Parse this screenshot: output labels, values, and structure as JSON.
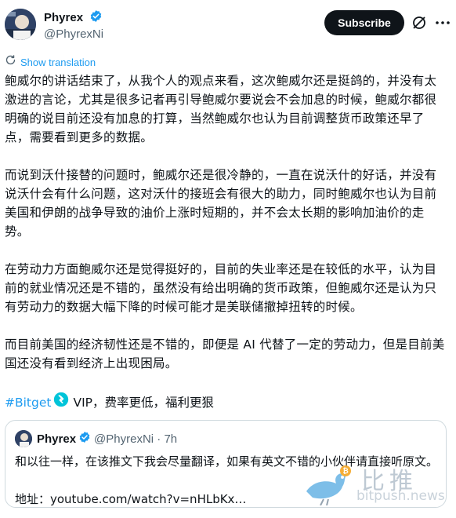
{
  "author": {
    "display_name": "Phyrex",
    "handle": "@PhyrexNi"
  },
  "actions": {
    "subscribe_label": "Subscribe"
  },
  "translate": {
    "label": "Show translation"
  },
  "tweet": {
    "paragraphs": [
      "鲍威尔的讲话结束了，从我个人的观点来看，这次鲍威尔还是挺鸽的，并没有太激进的言论，尤其是很多记者再引导鲍威尔要说会不会加息的时候，鲍威尔都很明确的说目前还没有加息的打算，当然鲍威尔也认为目前调整货币政策还早了点，需要看到更多的数据。",
      "而说到沃什接替的问题时，鲍威尔还是很冷静的，一直在说沃什的好话，并没有说沃什会有什么问题，这对沃什的接班会有很大的助力，同时鲍威尔也认为目前美国和伊朗的战争导致的油价上涨时短期的，并不会太长期的影响加油价的走势。",
      "在劳动力方面鲍威尔还是觉得挺好的，目前的失业率还是在较低的水平，认为目前的就业情况还是不错的，虽然没有给出明确的货币政策，但鲍威尔还是认为只有劳动力的数据大幅下降的时候可能才是美联储撤掉扭转的时候。",
      "而目前美国的经济韧性还是不错的，即便是 AI 代替了一定的劳动力，但是目前美国还没有看到经济上出现困局。"
    ],
    "hashtag": "#Bitget",
    "promo_text": "VIP，费率更低，福利更狠"
  },
  "quote": {
    "display_name": "Phyrex",
    "handle_time": "@PhyrexNi · 7h",
    "line1": "和以往一样，在该推文下我会尽量翻译，如果有英文不错的小伙伴请直接听原文。",
    "line2": "地址：youtube.com/watch?v=nHLbKx…"
  },
  "watermark": {
    "title": "比推",
    "site": "bitpush.news"
  },
  "colors": {
    "accent": "#1d9bf0",
    "text": "#0f1419",
    "muted": "#536471",
    "border": "#cfd9de",
    "bitget": "#00c4d9"
  },
  "icons": {
    "verified": "verified-badge-icon",
    "grok": "grok-icon",
    "more": "more-options-icon",
    "translate": "translate-icon",
    "bitget": "bitget-logo-icon",
    "bird": "bitpush-bird-logo"
  }
}
